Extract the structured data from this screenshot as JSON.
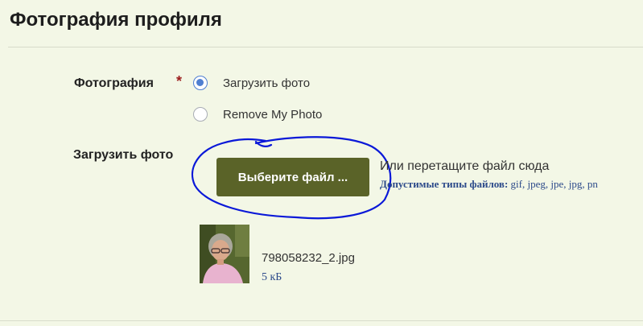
{
  "header": {
    "title": "Фотография профиля"
  },
  "photo_field": {
    "label": "Фотография",
    "required_marker": "*",
    "options": [
      {
        "label": "Загрузить фото",
        "selected": true
      },
      {
        "label": "Remove My Photo",
        "selected": false
      }
    ]
  },
  "upload_field": {
    "label": "Загрузить фото",
    "button_label": "Выберите файл ...",
    "drop_hint": "Или перетащите файл сюда",
    "allowed_types_label": "Допустимые типы файлов:",
    "allowed_types_value": "gif, jpeg, jpe, jpg, pn"
  },
  "uploaded_file": {
    "name": "798058232_2.jpg",
    "size": "5 кБ"
  },
  "colors": {
    "background": "#f3f7e6",
    "button": "#5a6328",
    "radio_selected": "#4f7fd1",
    "annotation": "#0a18d8",
    "link_text": "#2c4a8a",
    "required": "#9b1c1c"
  }
}
